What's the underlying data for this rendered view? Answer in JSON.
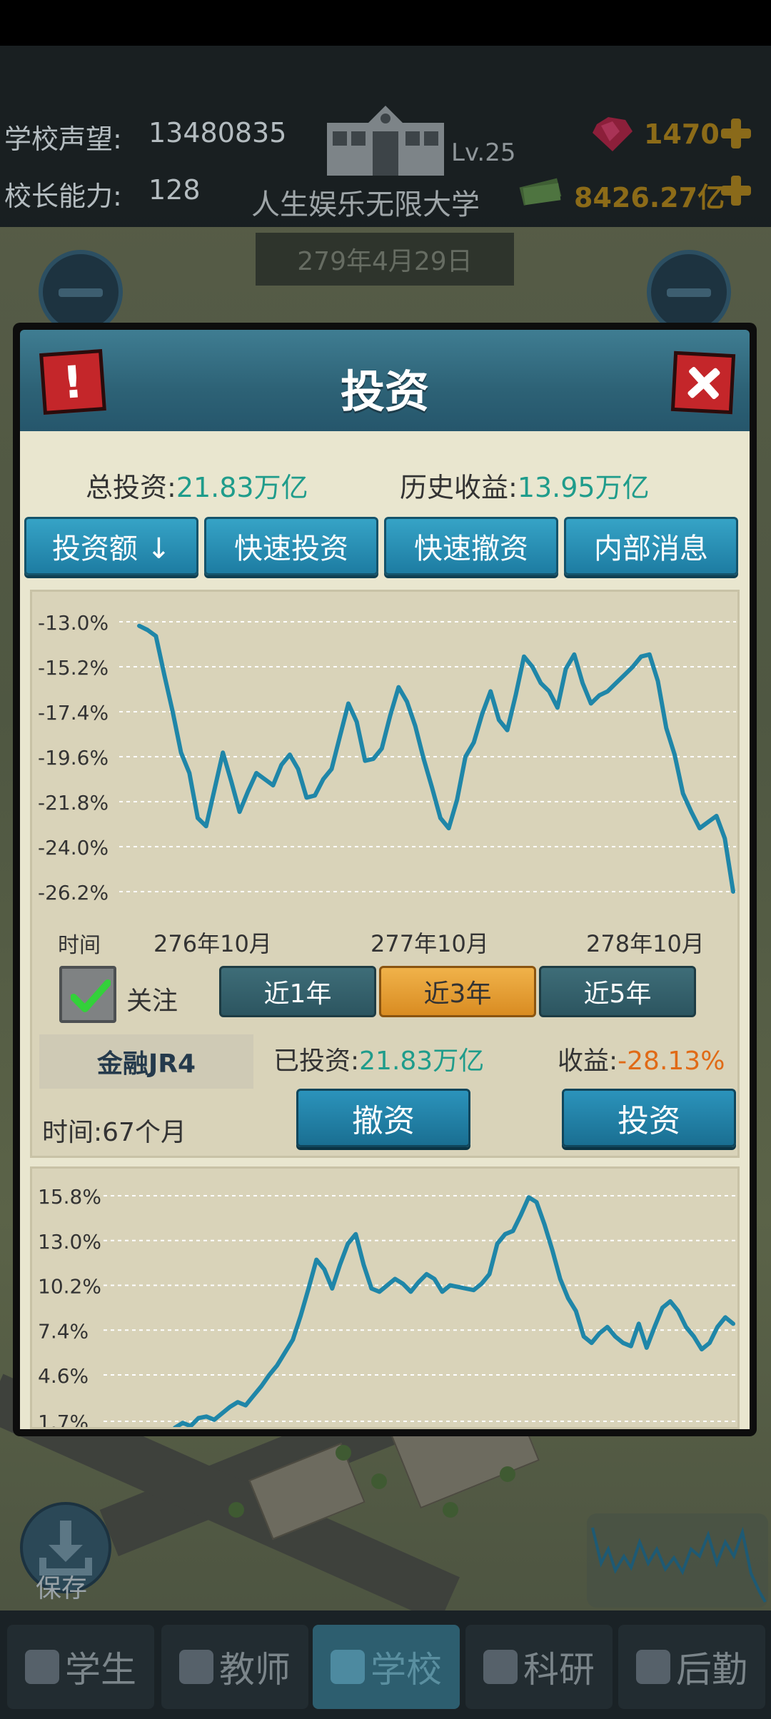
{
  "hud": {
    "reputation_label": "学校声望:",
    "reputation_value": "13480835",
    "principal_label": "校长能力:",
    "principal_value": "128",
    "level": "Lv.25",
    "school_name": "人生娱乐无限大学",
    "gems": "1470",
    "money": "8426.27亿",
    "date": "279年4月29日"
  },
  "dialog": {
    "title": "投资",
    "total_investment_label": "总投资:",
    "total_investment_value": "21.83万亿",
    "history_return_label": "历史收益:",
    "history_return_value": "13.95万亿",
    "tabs": [
      "投资额 ↓",
      "快速投资",
      "快速撤资",
      "内部消息"
    ],
    "time_label": "时间",
    "follow_label": "关注",
    "follow_checked": true,
    "ranges": [
      "近1年",
      "近3年",
      "近5年"
    ],
    "active_range": "近3年",
    "fund_name": "金融JR4",
    "invested_label": "已投资:",
    "invested_value": "21.83万亿",
    "return_label": "收益:",
    "return_value": "-28.13%",
    "duration_label": "时间:",
    "duration_value": "67个月",
    "withdraw_button": "撤资",
    "invest_button": "投资"
  },
  "bottom": {
    "save_label": "保存",
    "nav": [
      "学生",
      "教师",
      "学校",
      "科研",
      "后勤"
    ],
    "active_nav": "学校"
  },
  "colors": {
    "line": "#1f86a8",
    "teal_text": "#1f9c8b",
    "negative": "#e06a16",
    "active_tab": "#e9a53a"
  },
  "chart_data": [
    {
      "type": "line",
      "title": "",
      "xlabel": "时间",
      "ylabel": "",
      "ytick_labels": [
        "-13.0%",
        "-15.2%",
        "-17.4%",
        "-19.6%",
        "-21.8%",
        "-24.0%",
        "-26.2%"
      ],
      "xtick_labels": [
        "276年10月",
        "277年10月",
        "278年10月"
      ],
      "ylim": [
        -26.2,
        -13.0
      ],
      "grid": true,
      "x": [
        0,
        1,
        2,
        3,
        4,
        5,
        6,
        7,
        8,
        9,
        10,
        11,
        12,
        13,
        14,
        15,
        16,
        17,
        18,
        19,
        20,
        21,
        22,
        23,
        24,
        25,
        26,
        27,
        28,
        29,
        30,
        31,
        32,
        33,
        34,
        35,
        36,
        37,
        38,
        39,
        40,
        41,
        42,
        43,
        44,
        45,
        46,
        47,
        48,
        49,
        50,
        51,
        52,
        53,
        54,
        55,
        56,
        57,
        58,
        59,
        60,
        61,
        62,
        63,
        64,
        65,
        66,
        67,
        68,
        69,
        70,
        71
      ],
      "series": [
        {
          "values": [
            -13.2,
            -13.4,
            -13.7,
            -15.6,
            -17.4,
            -19.4,
            -20.4,
            -22.6,
            -23.0,
            -21.2,
            -19.4,
            -20.8,
            -22.3,
            -21.3,
            -20.4,
            -20.7,
            -21.0,
            -20.0,
            -19.5,
            -20.2,
            -21.6,
            -21.5,
            -20.7,
            -20.2,
            -18.6,
            -17.0,
            -17.9,
            -19.8,
            -19.7,
            -19.2,
            -17.6,
            -16.2,
            -16.9,
            -18.1,
            -19.7,
            -21.1,
            -22.6,
            -23.1,
            -21.7,
            -19.6,
            -18.9,
            -17.5,
            -16.4,
            -17.8,
            -18.3,
            -16.6,
            -14.7,
            -15.2,
            -16.0,
            -16.4,
            -17.2,
            -15.3,
            -14.6,
            -16.0,
            -17.0,
            -16.6,
            -16.4,
            -16.0,
            -15.6,
            -15.2,
            -14.7,
            -14.6,
            -15.9,
            -18.2,
            -19.5,
            -21.4,
            -22.3,
            -23.1,
            -22.8,
            -22.5,
            -23.6,
            -26.2
          ]
        }
      ]
    },
    {
      "type": "line",
      "title": "",
      "ytick_labels": [
        "15.8%",
        "13.0%",
        "10.2%",
        "7.4%",
        "4.6%",
        "1.7%"
      ],
      "ylim": [
        1.7,
        15.8
      ],
      "grid": true,
      "x": [
        0,
        1,
        2,
        3,
        4,
        5,
        6,
        7,
        8,
        9,
        10,
        11,
        12,
        13,
        14,
        15,
        16,
        17,
        18,
        19,
        20,
        21,
        22,
        23,
        24,
        25,
        26,
        27,
        28,
        29,
        30,
        31,
        32,
        33,
        34,
        35,
        36,
        37,
        38,
        39,
        40,
        41,
        42,
        43,
        44,
        45,
        46,
        47,
        48,
        49,
        50,
        51,
        52,
        53,
        54,
        55,
        56,
        57,
        58,
        59,
        60,
        61,
        62,
        63,
        64,
        65,
        66,
        67,
        68,
        69,
        70,
        71
      ],
      "series": [
        {
          "values": [
            1.3,
            1.6,
            1.4,
            1.9,
            2.0,
            1.8,
            2.2,
            2.6,
            2.9,
            2.7,
            3.3,
            3.9,
            4.6,
            5.2,
            6.0,
            6.8,
            8.3,
            10.0,
            11.8,
            11.2,
            10.0,
            11.5,
            12.8,
            13.4,
            11.5,
            10.0,
            9.8,
            10.2,
            10.6,
            10.3,
            9.8,
            10.4,
            10.9,
            10.6,
            9.8,
            10.2,
            10.1,
            10.0,
            9.9,
            10.3,
            10.9,
            12.8,
            13.4,
            13.6,
            14.6,
            15.7,
            15.4,
            14.0,
            12.4,
            10.6,
            9.4,
            8.6,
            7.0,
            6.6,
            7.2,
            7.6,
            7.0,
            6.6,
            6.4,
            7.8,
            6.3,
            7.6,
            8.8,
            9.2,
            8.6,
            7.6,
            7.0,
            6.2,
            6.6,
            7.6,
            8.2,
            7.8
          ]
        }
      ]
    }
  ]
}
